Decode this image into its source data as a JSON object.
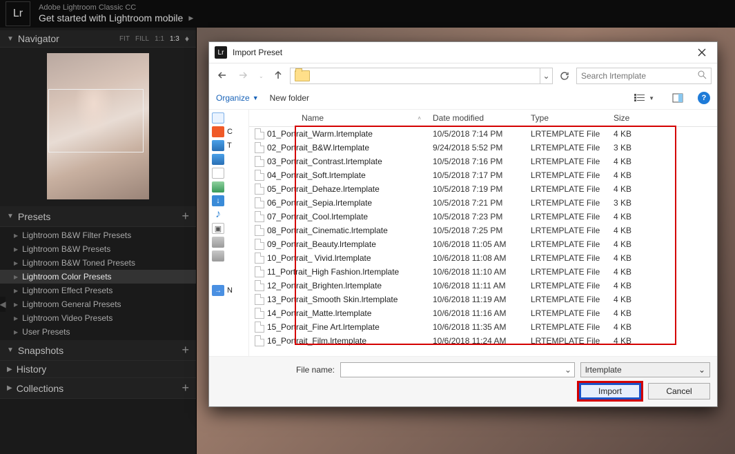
{
  "appbar": {
    "logo": "Lr",
    "subtitle": "Adobe Lightroom Classic CC",
    "title": "Get started with Lightroom mobile"
  },
  "navigator": {
    "title": "Navigator",
    "options": [
      "FIT",
      "FILL",
      "1:1",
      "1:3"
    ],
    "selected": "1:3"
  },
  "presets": {
    "title": "Presets",
    "items": [
      "Lightroom B&W Filter Presets",
      "Lightroom B&W Presets",
      "Lightroom B&W Toned Presets",
      "Lightroom Color Presets",
      "Lightroom Effect Presets",
      "Lightroom General Presets",
      "Lightroom Video Presets",
      "User Presets"
    ],
    "selected_index": 3
  },
  "sections": {
    "snapshots": "Snapshots",
    "history": "History",
    "collections": "Collections"
  },
  "dialog": {
    "title": "Import Preset",
    "search_placeholder": "Search lrtemplate",
    "organize": "Organize",
    "newfolder": "New folder",
    "columns": {
      "name": "Name",
      "date": "Date modified",
      "type": "Type",
      "size": "Size"
    },
    "files": [
      {
        "name": "01_Portrait_Warm.lrtemplate",
        "date": "10/5/2018 7:14 PM",
        "type": "LRTEMPLATE File",
        "size": "4 KB"
      },
      {
        "name": "02_Portrait_B&W.lrtemplate",
        "date": "9/24/2018 5:52 PM",
        "type": "LRTEMPLATE File",
        "size": "3 KB"
      },
      {
        "name": "03_Portrait_Contrast.lrtemplate",
        "date": "10/5/2018 7:16 PM",
        "type": "LRTEMPLATE File",
        "size": "4 KB"
      },
      {
        "name": "04_Portrait_Soft.lrtemplate",
        "date": "10/5/2018 7:17 PM",
        "type": "LRTEMPLATE File",
        "size": "4 KB"
      },
      {
        "name": "05_Portrait_Dehaze.lrtemplate",
        "date": "10/5/2018 7:19 PM",
        "type": "LRTEMPLATE File",
        "size": "4 KB"
      },
      {
        "name": "06_Portrait_Sepia.lrtemplate",
        "date": "10/5/2018 7:21 PM",
        "type": "LRTEMPLATE File",
        "size": "3 KB"
      },
      {
        "name": "07_Portrait_Cool.lrtemplate",
        "date": "10/5/2018 7:23 PM",
        "type": "LRTEMPLATE File",
        "size": "4 KB"
      },
      {
        "name": "08_Portrait_Cinematic.lrtemplate",
        "date": "10/5/2018 7:25 PM",
        "type": "LRTEMPLATE File",
        "size": "4 KB"
      },
      {
        "name": "09_Portrait_Beauty.lrtemplate",
        "date": "10/6/2018 11:05 AM",
        "type": "LRTEMPLATE File",
        "size": "4 KB"
      },
      {
        "name": "10_Portrait_ Vivid.lrtemplate",
        "date": "10/6/2018 11:08 AM",
        "type": "LRTEMPLATE File",
        "size": "4 KB"
      },
      {
        "name": "11_Portrait_High Fashion.lrtemplate",
        "date": "10/6/2018 11:10 AM",
        "type": "LRTEMPLATE File",
        "size": "4 KB"
      },
      {
        "name": "12_Portrait_Brighten.lrtemplate",
        "date": "10/6/2018 11:11 AM",
        "type": "LRTEMPLATE File",
        "size": "4 KB"
      },
      {
        "name": "13_Portrait_Smooth Skin.lrtemplate",
        "date": "10/6/2018 11:19 AM",
        "type": "LRTEMPLATE File",
        "size": "4 KB"
      },
      {
        "name": "14_Portrait_Matte.lrtemplate",
        "date": "10/6/2018 11:16 AM",
        "type": "LRTEMPLATE File",
        "size": "4 KB"
      },
      {
        "name": "15_Portrait_Fine Art.lrtemplate",
        "date": "10/6/2018 11:35 AM",
        "type": "LRTEMPLATE File",
        "size": "4 KB"
      },
      {
        "name": "16_Portrait_Film.lrtemplate",
        "date": "10/6/2018 11:24 AM",
        "type": "LRTEMPLATE File",
        "size": "4 KB"
      }
    ],
    "places_label": "N",
    "filename_label": "File name:",
    "filter_label": "lrtemplate",
    "import": "Import",
    "cancel": "Cancel"
  }
}
